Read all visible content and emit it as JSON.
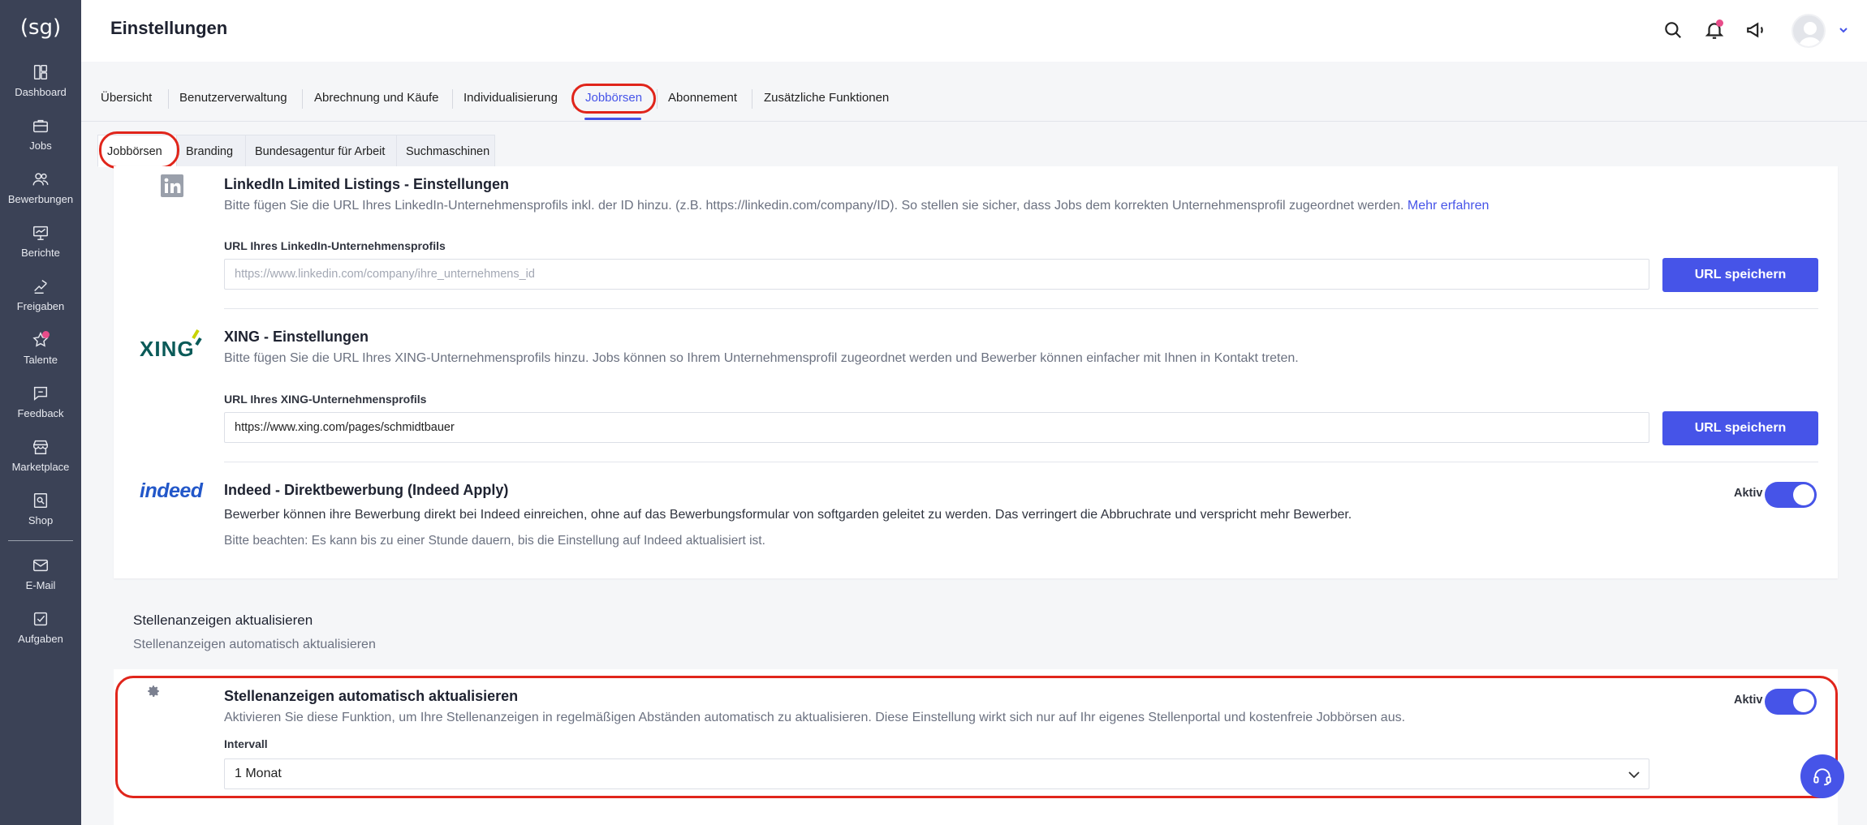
{
  "app": {
    "logo_text": "(sg)"
  },
  "sidebar": {
    "items": [
      {
        "label": "Dashboard"
      },
      {
        "label": "Jobs"
      },
      {
        "label": "Bewerbungen"
      },
      {
        "label": "Berichte"
      },
      {
        "label": "Freigaben"
      },
      {
        "label": "Talente"
      },
      {
        "label": "Feedback"
      },
      {
        "label": "Marketplace"
      },
      {
        "label": "Shop"
      },
      {
        "label": "E-Mail"
      },
      {
        "label": "Aufgaben"
      }
    ]
  },
  "header": {
    "title": "Einstellungen"
  },
  "tabs": [
    {
      "label": "Übersicht"
    },
    {
      "label": "Benutzerverwaltung"
    },
    {
      "label": "Abrechnung und Käufe"
    },
    {
      "label": "Individualisierung"
    },
    {
      "label": "Jobbörsen",
      "active": true
    },
    {
      "label": "Abonnement"
    },
    {
      "label": "Zusätzliche Funktionen"
    }
  ],
  "subtabs": [
    {
      "label": "Jobbörsen",
      "active": true
    },
    {
      "label": "Branding"
    },
    {
      "label": "Bundesagentur für Arbeit"
    },
    {
      "label": "Suchmaschinen"
    }
  ],
  "linkedin": {
    "title": "LinkedIn Limited Listings - Einstellungen",
    "description": "Bitte fügen Sie die URL Ihres LinkedIn-Unternehmensprofils inkl. der ID hinzu. (z.B. https://linkedin.com/company/ID). So stellen sie sicher, dass Jobs dem korrekten Unternehmensprofil zugeordnet werden.",
    "link_text": "Mehr erfahren",
    "field_label": "URL Ihres LinkedIn-Unternehmensprofils",
    "placeholder": "https://www.linkedin.com/company/ihre_unternehmens_id",
    "value": "",
    "button": "URL speichern"
  },
  "xing": {
    "logo_text": "XING",
    "title": "XING - Einstellungen",
    "description": "Bitte fügen Sie die URL Ihres XING-Unternehmensprofils hinzu. Jobs können so Ihrem Unternehmensprofil zugeordnet werden und Bewerber können einfacher mit Ihnen in Kontakt treten.",
    "field_label": "URL Ihres XING-Unternehmensprofils",
    "value": "https://www.xing.com/pages/schmidtbauer",
    "button": "URL speichern"
  },
  "indeed": {
    "logo_text": "indeed",
    "title": "Indeed - Direktbewerbung (Indeed Apply)",
    "description": "Bewerber können ihre Bewerbung direkt bei Indeed einreichen, ohne auf das Bewerbungsformular von softgarden geleitet zu werden. Das verringert die Abbruchrate und verspricht mehr Bewerber.",
    "note": "Bitte beachten: Es kann bis zu einer Stunde dauern, bis die Einstellung auf Indeed aktualisiert ist.",
    "toggle_label": "Aktiv",
    "toggle_on": true
  },
  "refresh_section": {
    "title": "Stellenanzeigen aktualisieren",
    "subtitle": "Stellenanzeigen automatisch aktualisieren"
  },
  "auto_refresh": {
    "title": "Stellenanzeigen automatisch aktualisieren",
    "description": "Aktivieren Sie diese Funktion, um Ihre Stellenanzeigen in regelmäßigen Abständen automatisch zu aktualisieren. Diese Einstellung wirkt sich nur auf Ihr eigenes Stellenportal und kostenfreie Jobbörsen aus.",
    "toggle_label": "Aktiv",
    "toggle_on": true,
    "interval_label": "Intervall",
    "interval_value": "1 Monat"
  },
  "colors": {
    "accent": "#4654e8",
    "sidebar": "#3b4256",
    "highlight": "#e0251b",
    "notification": "#e84d8a"
  }
}
